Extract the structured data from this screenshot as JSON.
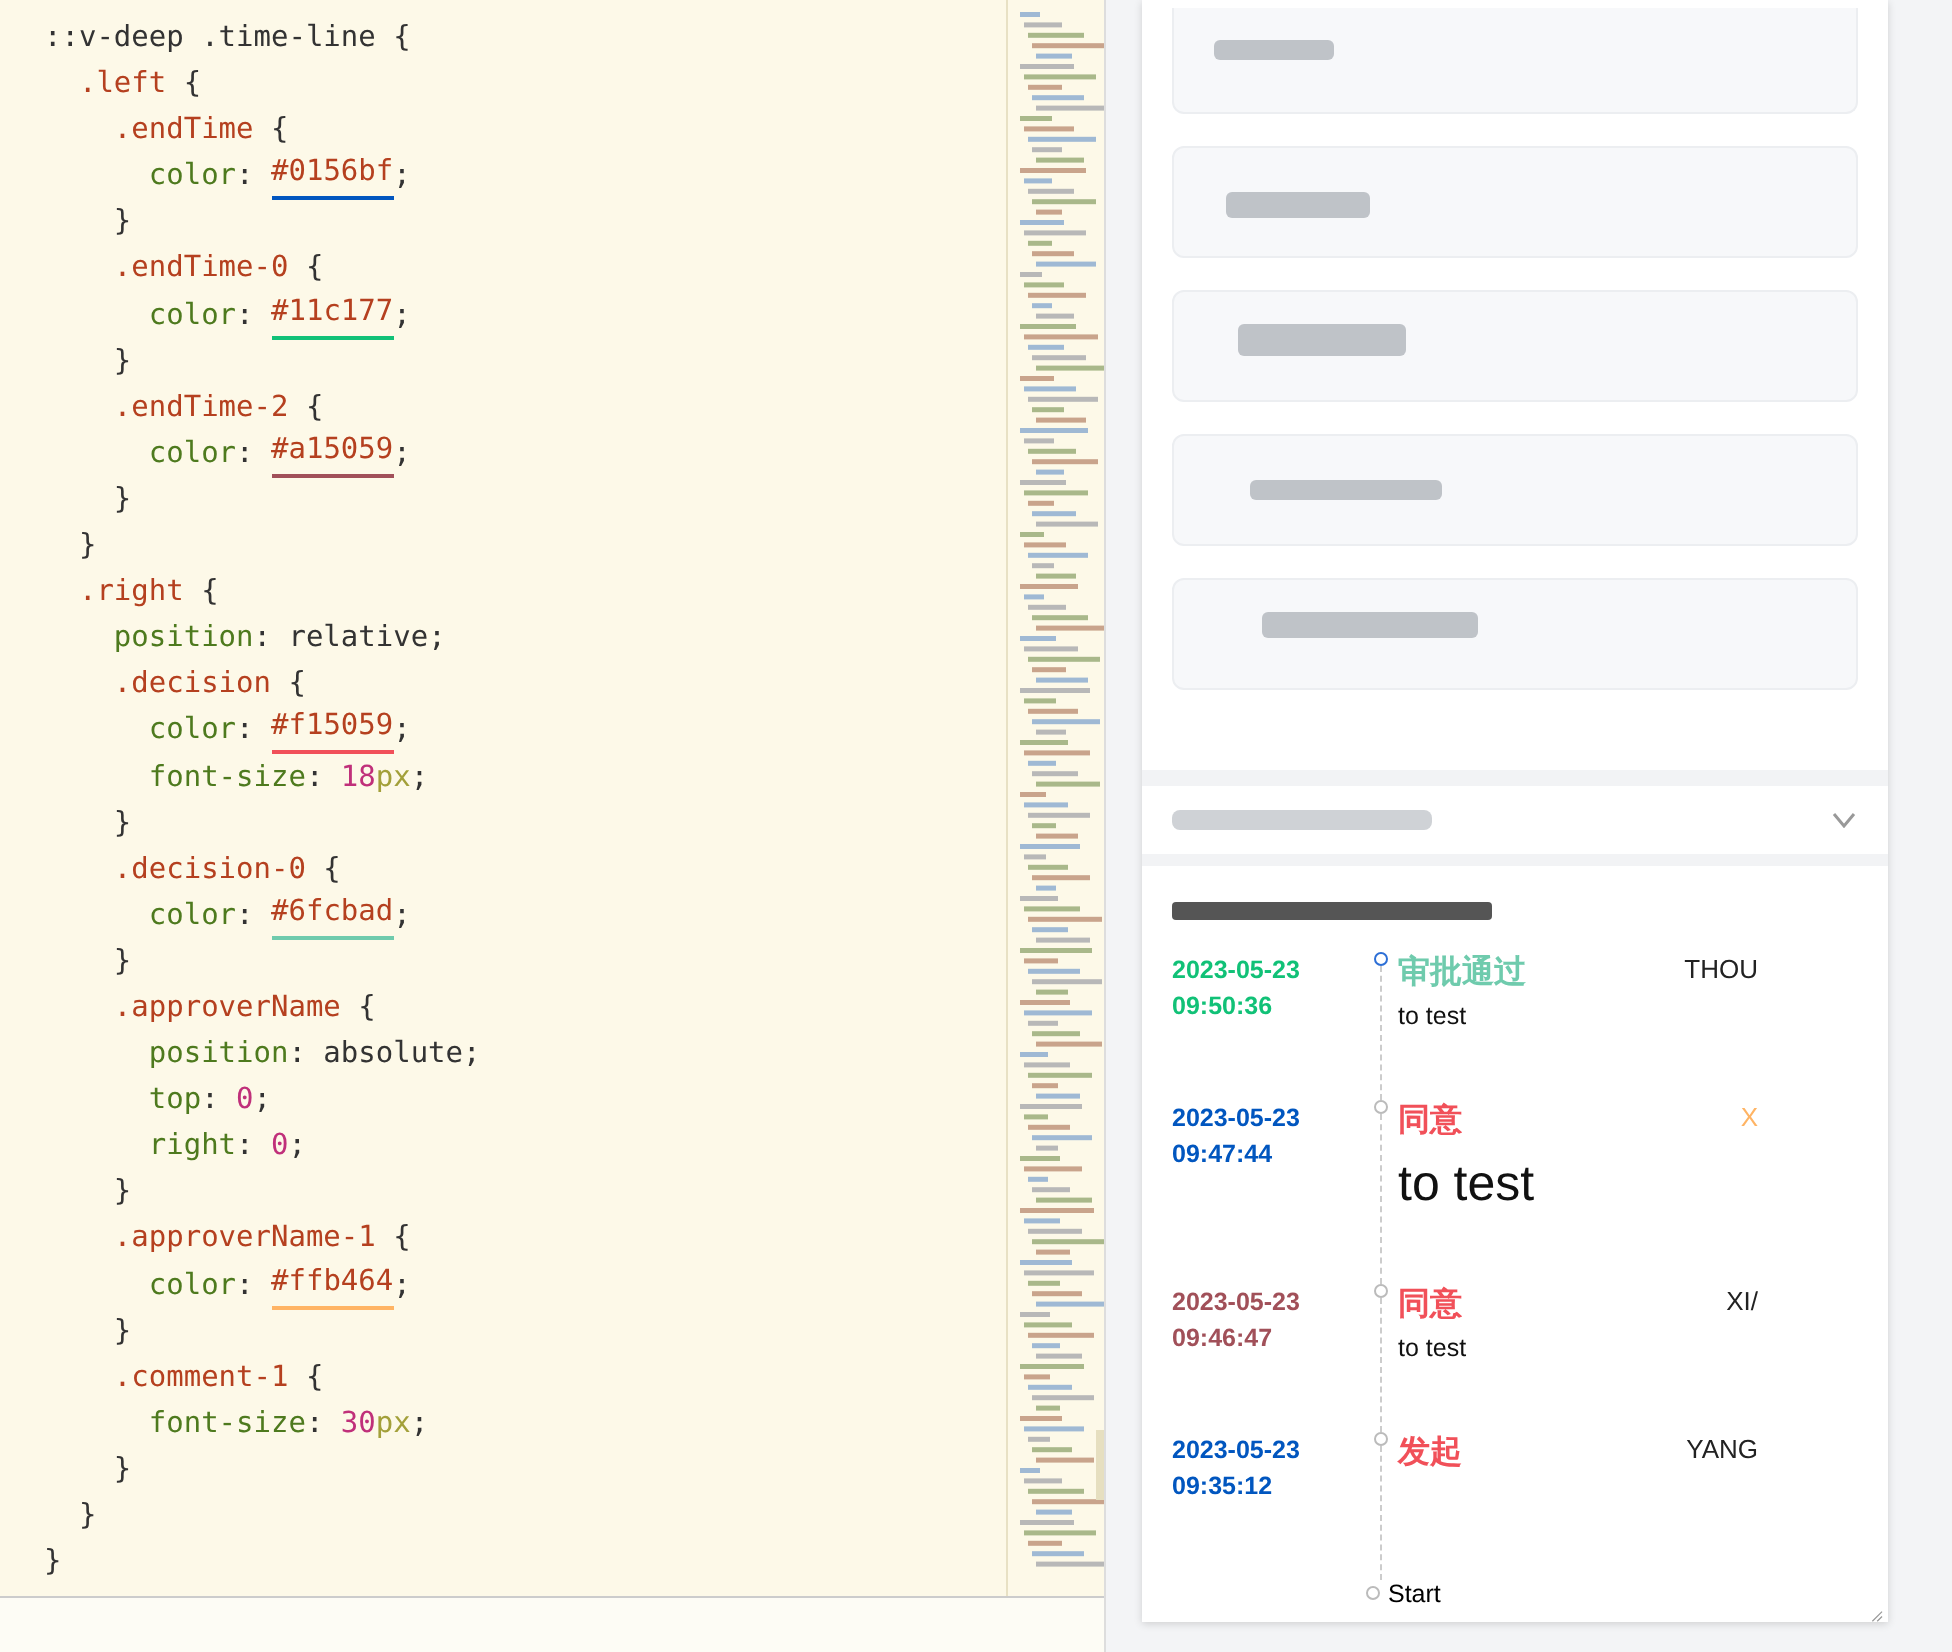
{
  "editor": {
    "lines": [
      [
        {
          "text": "::v-deep .time-line",
          "kind": "selector-plain"
        },
        {
          "text": " {",
          "kind": "plain"
        }
      ],
      [
        {
          "text": "  .left",
          "kind": "selector"
        },
        {
          "text": " {",
          "kind": "plain"
        }
      ],
      [
        {
          "text": "    .endTime",
          "kind": "selector"
        },
        {
          "text": " {",
          "kind": "plain"
        }
      ],
      [
        {
          "text": "      color",
          "kind": "prop"
        },
        {
          "text": ": ",
          "kind": "plain"
        },
        {
          "text": "#0156bf",
          "kind": "hex",
          "color": "#0156bf"
        },
        {
          "text": ";",
          "kind": "plain"
        }
      ],
      [
        {
          "text": "    }",
          "kind": "plain"
        }
      ],
      [
        {
          "text": "    .endTime-0",
          "kind": "selector"
        },
        {
          "text": " {",
          "kind": "plain"
        }
      ],
      [
        {
          "text": "      color",
          "kind": "prop"
        },
        {
          "text": ": ",
          "kind": "plain"
        },
        {
          "text": "#11c177",
          "kind": "hex",
          "color": "#11c177"
        },
        {
          "text": ";",
          "kind": "plain"
        }
      ],
      [
        {
          "text": "    }",
          "kind": "plain"
        }
      ],
      [
        {
          "text": "    .endTime-2",
          "kind": "selector"
        },
        {
          "text": " {",
          "kind": "plain"
        }
      ],
      [
        {
          "text": "      color",
          "kind": "prop"
        },
        {
          "text": ": ",
          "kind": "plain"
        },
        {
          "text": "#a15059",
          "kind": "hex",
          "color": "#a15059"
        },
        {
          "text": ";",
          "kind": "plain"
        }
      ],
      [
        {
          "text": "    }",
          "kind": "plain"
        }
      ],
      [
        {
          "text": "  }",
          "kind": "plain"
        }
      ],
      [
        {
          "text": "  .right",
          "kind": "selector"
        },
        {
          "text": " {",
          "kind": "plain"
        }
      ],
      [
        {
          "text": "    position",
          "kind": "prop"
        },
        {
          "text": ": relative;",
          "kind": "plain"
        }
      ],
      [
        {
          "text": "    .decision",
          "kind": "selector"
        },
        {
          "text": " {",
          "kind": "plain"
        }
      ],
      [
        {
          "text": "      color",
          "kind": "prop"
        },
        {
          "text": ": ",
          "kind": "plain"
        },
        {
          "text": "#f15059",
          "kind": "hex",
          "color": "#f15059"
        },
        {
          "text": ";",
          "kind": "plain"
        }
      ],
      [
        {
          "text": "      font-size",
          "kind": "prop"
        },
        {
          "text": ": ",
          "kind": "plain"
        },
        {
          "text": "18",
          "kind": "number"
        },
        {
          "text": "px",
          "kind": "unit"
        },
        {
          "text": ";",
          "kind": "plain"
        }
      ],
      [
        {
          "text": "    }",
          "kind": "plain"
        }
      ],
      [
        {
          "text": "    .decision-0",
          "kind": "selector"
        },
        {
          "text": " {",
          "kind": "plain"
        }
      ],
      [
        {
          "text": "      color",
          "kind": "prop"
        },
        {
          "text": ": ",
          "kind": "plain"
        },
        {
          "text": "#6fcbad",
          "kind": "hex",
          "color": "#6fcbad"
        },
        {
          "text": ";",
          "kind": "plain"
        }
      ],
      [
        {
          "text": "    }",
          "kind": "plain"
        }
      ],
      [
        {
          "text": "    .approverName",
          "kind": "selector"
        },
        {
          "text": " {",
          "kind": "plain"
        }
      ],
      [
        {
          "text": "      position",
          "kind": "prop"
        },
        {
          "text": ": absolute;",
          "kind": "plain"
        }
      ],
      [
        {
          "text": "      top",
          "kind": "prop"
        },
        {
          "text": ": ",
          "kind": "plain"
        },
        {
          "text": "0",
          "kind": "number"
        },
        {
          "text": ";",
          "kind": "plain"
        }
      ],
      [
        {
          "text": "      right",
          "kind": "prop"
        },
        {
          "text": ": ",
          "kind": "plain"
        },
        {
          "text": "0",
          "kind": "number"
        },
        {
          "text": ";",
          "kind": "plain"
        }
      ],
      [
        {
          "text": "    }",
          "kind": "plain"
        }
      ],
      [
        {
          "text": "    .approverName-1",
          "kind": "selector"
        },
        {
          "text": " {",
          "kind": "plain"
        }
      ],
      [
        {
          "text": "      color",
          "kind": "prop"
        },
        {
          "text": ": ",
          "kind": "plain"
        },
        {
          "text": "#ffb464",
          "kind": "hex",
          "color": "#ffb464"
        },
        {
          "text": ";",
          "kind": "plain"
        }
      ],
      [
        {
          "text": "    }",
          "kind": "plain"
        }
      ],
      [
        {
          "text": "    .comment-1",
          "kind": "selector"
        },
        {
          "text": " {",
          "kind": "plain"
        }
      ],
      [
        {
          "text": "      font-size",
          "kind": "prop"
        },
        {
          "text": ": ",
          "kind": "plain"
        },
        {
          "text": "30",
          "kind": "number"
        },
        {
          "text": "px",
          "kind": "unit"
        },
        {
          "text": ";",
          "kind": "plain"
        }
      ],
      [
        {
          "text": "    }",
          "kind": "plain"
        }
      ],
      [
        {
          "text": "  }",
          "kind": "plain"
        }
      ],
      [
        {
          "text": "}",
          "kind": "plain"
        }
      ]
    ]
  },
  "detail_cards": [
    {
      "kind": "redacted"
    },
    {
      "kind": "redacted"
    },
    {
      "kind": "redacted"
    },
    {
      "kind": "redacted"
    },
    {
      "kind": "redacted"
    }
  ],
  "collapsible_section": {
    "expanded": false
  },
  "timeline": {
    "entries": [
      {
        "date": {
          "text": "2023-05-23",
          "color": "#11c177"
        },
        "time": {
          "text": "09:50:36",
          "color": "#11c177"
        },
        "active": true,
        "decision": {
          "text": "审批通过",
          "color": "#6fcbad"
        },
        "comment": {
          "text": "to test",
          "kind": "normal"
        },
        "approver": {
          "text": "THOU",
          "color": "#222222"
        }
      },
      {
        "date": {
          "text": "2023-05-23",
          "color": "#0156bf"
        },
        "time": {
          "text": "09:47:44",
          "color": "#0156bf"
        },
        "active": false,
        "decision": {
          "text": "同意",
          "color": "#f15059"
        },
        "comment": {
          "text": "to test",
          "kind": "large"
        },
        "approver": {
          "text": "X",
          "color": "#ffb464"
        }
      },
      {
        "date": {
          "text": "2023-05-23",
          "color": "#a15059"
        },
        "time": {
          "text": "09:46:47",
          "color": "#a15059"
        },
        "active": false,
        "decision": {
          "text": "同意",
          "color": "#f15059"
        },
        "comment": {
          "text": "to test",
          "kind": "normal"
        },
        "approver": {
          "text": "XI/",
          "color": "#222222"
        }
      },
      {
        "date": {
          "text": "2023-05-23",
          "color": "#0156bf"
        },
        "time": {
          "text": "09:35:12",
          "color": "#0156bf"
        },
        "active": false,
        "decision": {
          "text": "发起",
          "color": "#f15059"
        },
        "approver": {
          "text": "YANG",
          "color": "#222222"
        }
      }
    ],
    "end_label": "Start"
  }
}
